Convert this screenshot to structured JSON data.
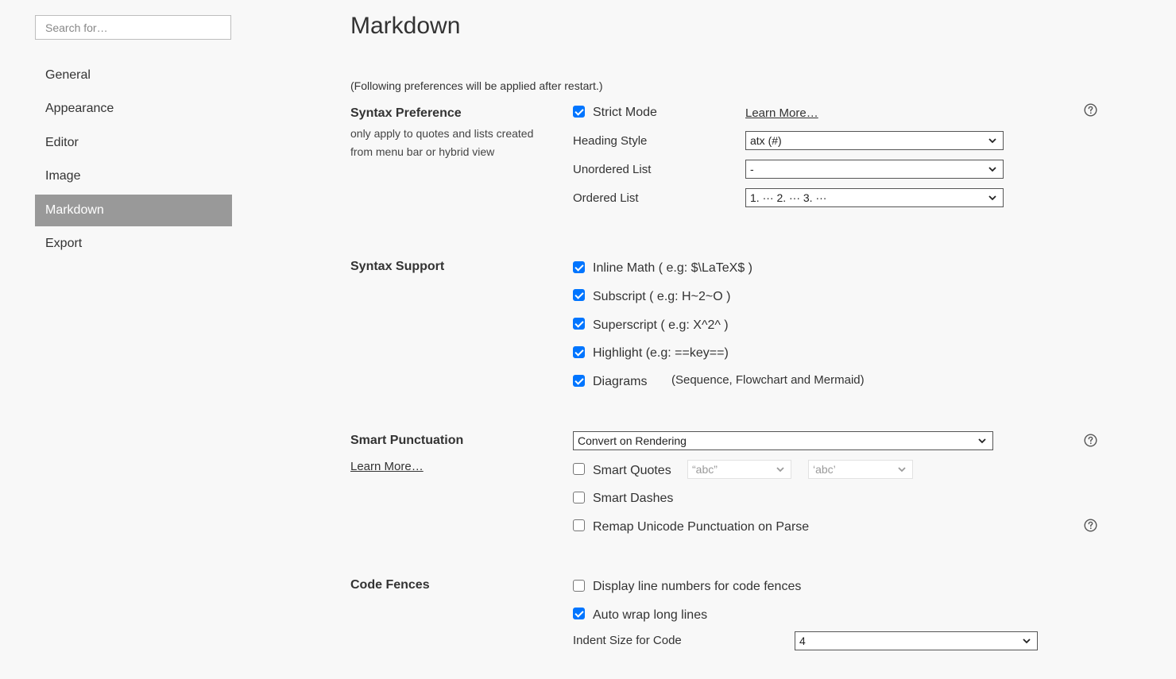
{
  "sidebar": {
    "search_placeholder": "Search for…",
    "items": [
      {
        "label": "General"
      },
      {
        "label": "Appearance"
      },
      {
        "label": "Editor"
      },
      {
        "label": "Image"
      },
      {
        "label": "Markdown"
      },
      {
        "label": "Export"
      }
    ],
    "active_item": "Markdown"
  },
  "main": {
    "title": "Markdown",
    "restart_note": "(Following preferences will be applied after restart.)",
    "syntax_preference": {
      "title": "Syntax Preference",
      "description_line1": "only apply to quotes and lists created",
      "description_line2": "from menu bar or hybrid view",
      "strict_mode_label": "Strict Mode",
      "strict_mode_checked": true,
      "learn_more": "Learn More…",
      "heading_style_label": "Heading Style",
      "heading_style_value": "atx (#)",
      "unordered_list_label": "Unordered List",
      "unordered_list_value": "-",
      "ordered_list_label": "Ordered List",
      "ordered_list_value": "1. ··· 2. ··· 3. ···"
    },
    "syntax_support": {
      "title": "Syntax Support",
      "items": [
        {
          "label": "Inline Math ( e.g: $\\LaTeX$ )",
          "checked": true
        },
        {
          "label": "Subscript ( e.g: H~2~O )",
          "checked": true
        },
        {
          "label": "Superscript ( e.g: X^2^ )",
          "checked": true
        },
        {
          "label": "Highlight (e.g: ==key==)",
          "checked": true
        },
        {
          "label": "Diagrams",
          "checked": true
        }
      ],
      "diagrams_hint": "(Sequence, Flowchart and Mermaid)"
    },
    "smart_punctuation": {
      "title": "Smart Punctuation",
      "learn_more": "Learn More…",
      "mode_value": "Convert on Rendering",
      "smart_quotes_label": "Smart Quotes",
      "smart_quotes_checked": false,
      "double_quote_value": "“abc”",
      "single_quote_value": "‘abc’",
      "smart_dashes_label": "Smart Dashes",
      "smart_dashes_checked": false,
      "remap_label": "Remap Unicode Punctuation on Parse",
      "remap_checked": false
    },
    "code_fences": {
      "title": "Code Fences",
      "line_numbers_label": "Display line numbers for code fences",
      "line_numbers_checked": false,
      "auto_wrap_label": "Auto wrap long lines",
      "auto_wrap_checked": true,
      "indent_label": "Indent Size for Code",
      "indent_value": "4"
    }
  },
  "icons": {
    "help": "question-circle-icon",
    "dropdown": "chevron-down-icon",
    "check": "checkmark-icon"
  },
  "colors": {
    "checkbox_accent": "#0075ff",
    "active_nav_bg": "#999999",
    "background": "#f8f8f8"
  }
}
